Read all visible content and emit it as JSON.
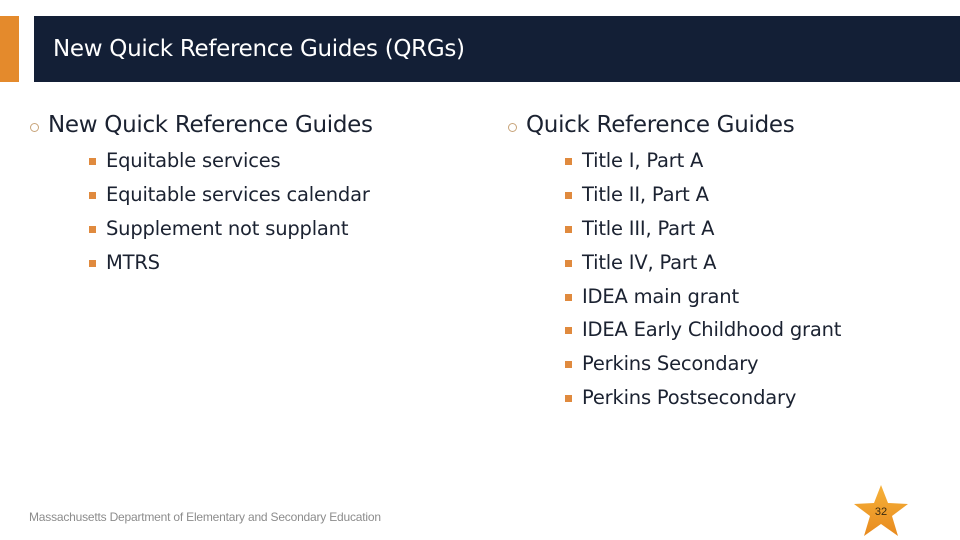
{
  "header": {
    "title": "New Quick Reference Guides (QRGs)",
    "colors": {
      "background": "#131f36",
      "accent": "#e48a2c",
      "text": "#ffffff"
    }
  },
  "left_column": {
    "heading": "New Quick Reference Guides",
    "items": [
      "Equitable services",
      "Equitable services calendar",
      "Supplement not supplant",
      "MTRS"
    ]
  },
  "right_column": {
    "heading": "Quick Reference Guides",
    "items": [
      "Title I, Part A",
      "Title II, Part A",
      "Title III, Part A",
      "Title IV, Part A",
      "IDEA main grant",
      "IDEA Early Childhood grant",
      "Perkins Secondary",
      "Perkins Postsecondary"
    ]
  },
  "footer": {
    "organization": "Massachusetts Department of Elementary and Secondary Education",
    "page_number": "32",
    "page_badge_icon": "star-icon"
  }
}
